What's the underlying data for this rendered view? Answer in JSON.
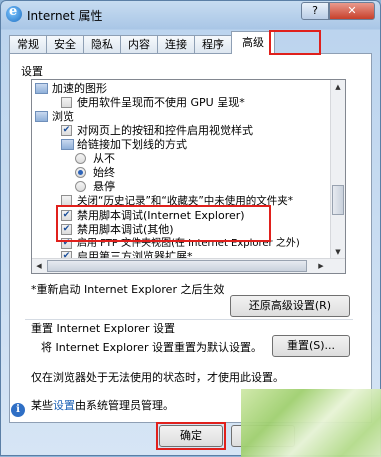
{
  "window": {
    "title": "Internet 属性",
    "help_label": "?",
    "close_label": "✕"
  },
  "tabs": [
    {
      "label": "常规"
    },
    {
      "label": "安全"
    },
    {
      "label": "隐私"
    },
    {
      "label": "内容"
    },
    {
      "label": "连接"
    },
    {
      "label": "程序"
    },
    {
      "label": "高级",
      "active": true
    }
  ],
  "settings": {
    "group_label": "设置",
    "rows": [
      {
        "kind": "folder",
        "text": "加速的图形"
      },
      {
        "kind": "checkbox",
        "checked": false,
        "text": "使用软件呈现而不使用 GPU 呈现*"
      },
      {
        "kind": "folder",
        "text": "浏览"
      },
      {
        "kind": "checkbox",
        "checked": true,
        "text": "对网页上的按钮和控件启用视觉样式"
      },
      {
        "kind": "folder",
        "text": "给链接加下划线的方式"
      },
      {
        "kind": "radio",
        "checked": false,
        "text": "从不"
      },
      {
        "kind": "radio",
        "checked": true,
        "text": "始终"
      },
      {
        "kind": "radio",
        "checked": false,
        "text": "悬停"
      },
      {
        "kind": "checkbox",
        "checked": false,
        "text": "关闭“历史记录”和“收藏夹”中未使用的文件夹*"
      },
      {
        "kind": "checkbox",
        "checked": true,
        "text": "禁用脚本调试(Internet Explorer)"
      },
      {
        "kind": "checkbox",
        "checked": true,
        "text": "禁用脚本调试(其他)"
      },
      {
        "kind": "checkbox",
        "checked": true,
        "text": "启用 FTP 文件夹视图(在 Internet Explorer 之外)"
      },
      {
        "kind": "checkbox",
        "checked": true,
        "text": "启用第三方浏览器扩展*"
      }
    ]
  },
  "restart_note": "*重新启动 Internet Explorer 之后生效",
  "restore_button": "还原高级设置(R)",
  "reset": {
    "label": "重置 Internet Explorer 设置",
    "desc": "将 Internet Explorer 设置重置为默认设置。",
    "button": "重置(S)...",
    "info": "仅在浏览器处于无法使用的状态时，才使用此设置。"
  },
  "bottom_info": {
    "prefix": "某些",
    "link": "设置",
    "suffix": "由系统管理员管理。"
  },
  "ok_button": "确定",
  "colors": {
    "highlight": "#e0201c",
    "link": "#1a5fb4"
  }
}
